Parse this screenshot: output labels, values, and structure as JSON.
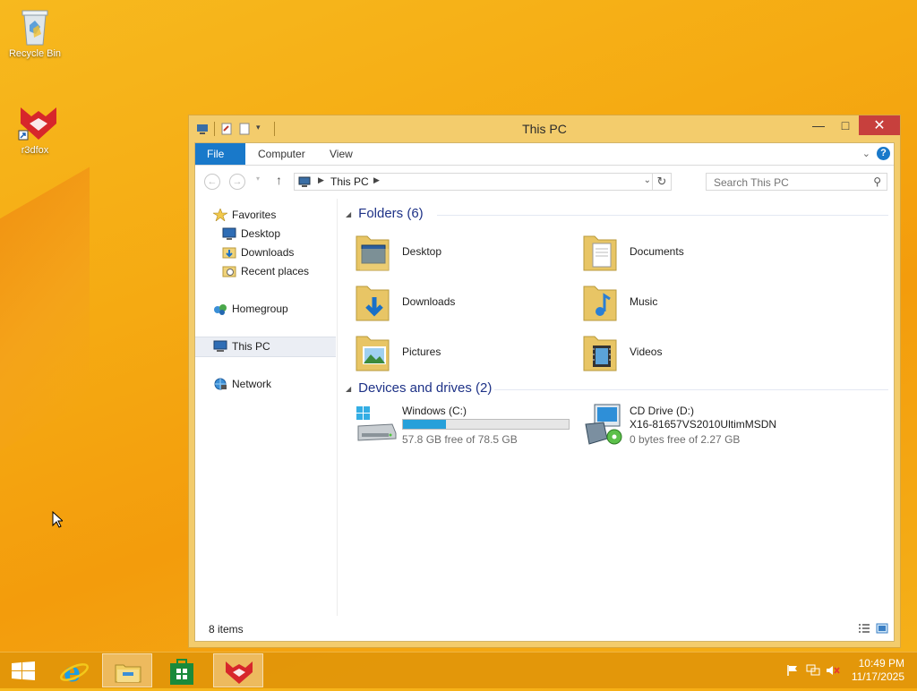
{
  "desktop": {
    "icons": [
      {
        "label": "Recycle Bin"
      },
      {
        "label": "r3dfox"
      }
    ]
  },
  "window": {
    "title": "This PC",
    "controls": {
      "minimize": "—",
      "maximize": "□",
      "close": "✕"
    },
    "ribbon_tabs": [
      "File",
      "Computer",
      "View"
    ],
    "address": {
      "crumb": "This PC"
    },
    "search_placeholder": "Search This PC",
    "nav": {
      "favorites": "Favorites",
      "desktop": "Desktop",
      "downloads": "Downloads",
      "recent": "Recent places",
      "homegroup": "Homegroup",
      "thispc": "This PC",
      "network": "Network"
    },
    "folders_header": "Folders (6)",
    "folders": [
      "Desktop",
      "Documents",
      "Downloads",
      "Music",
      "Pictures",
      "Videos"
    ],
    "drives_header": "Devices and drives (2)",
    "drives": [
      {
        "name": "Windows (C:)",
        "free": "57.8 GB free of 78.5 GB",
        "used_fraction": 0.26
      },
      {
        "name": "CD Drive (D:)",
        "label": "X16-81657VS2010UltimMSDN",
        "free": "0 bytes free of 2.27 GB"
      }
    ],
    "status": "8 items"
  },
  "taskbar": {
    "clock_time": "10:49 PM",
    "clock_date": "11/17/2025"
  }
}
